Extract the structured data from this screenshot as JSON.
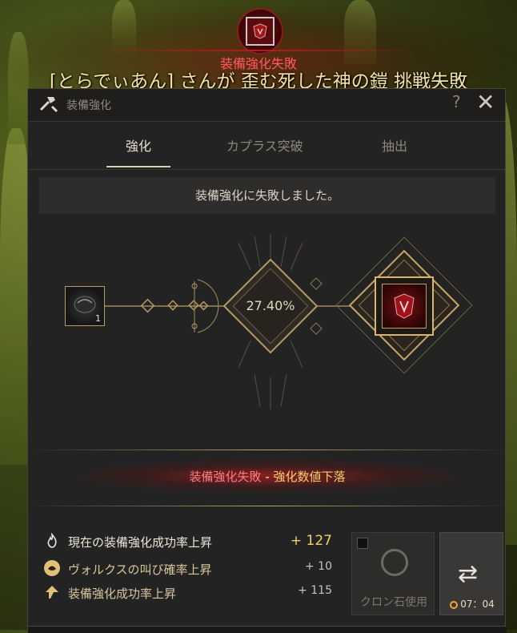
{
  "banner": {
    "title": "装備強化失敗",
    "message": "[とらでぃあん] さんが 歪む死した神の鎧 挑戦失敗"
  },
  "window": {
    "title": "装備強化",
    "help": "?",
    "close": "✕"
  },
  "tabs": [
    {
      "label": "強化",
      "active": true
    },
    {
      "label": "カプラス突破",
      "active": false
    },
    {
      "label": "抽出",
      "active": false
    }
  ],
  "notice": "装備強化に失敗しました。",
  "enhance": {
    "stone_count": "1",
    "chance": "27.40%"
  },
  "result": {
    "part_a": "装備強化失敗",
    "separator": " - ",
    "part_b": "強化数値下落"
  },
  "stats": [
    {
      "label": "現在の装備強化成功率上昇",
      "value": "+ 127",
      "icon": "flame-icon"
    },
    {
      "label": "ヴォルクスの叫び確率上昇",
      "value": "+ 10",
      "icon": "volks-icon"
    },
    {
      "label": "装備強化成功率上昇",
      "value": "+ 115",
      "icon": "arrow-up-icon"
    }
  ],
  "cron": {
    "label": "クロン石使用"
  },
  "swap": {
    "icon": "⇄",
    "timer": "07：04"
  },
  "colors": {
    "accent_gold": "#d8b66f",
    "fail_red": "#ff7a82",
    "value_gold": "#f5cf6a"
  }
}
